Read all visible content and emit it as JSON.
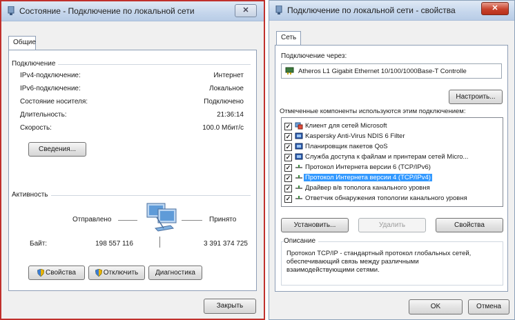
{
  "left_window": {
    "title": "Состояние - Подключение по локальной сети",
    "close_label": "✕",
    "tab": "Общие",
    "connection_group": "Подключение",
    "rows": [
      {
        "label": "IPv4-подключение:",
        "value": "Интернет"
      },
      {
        "label": "IPv6-подключение:",
        "value": "Локальное"
      },
      {
        "label": "Состояние носителя:",
        "value": "Подключено"
      },
      {
        "label": "Длительность:",
        "value": "21:36:14"
      },
      {
        "label": "Скорость:",
        "value": "100.0 Мбит/с"
      }
    ],
    "details_button": "Сведения...",
    "activity_group": "Активность",
    "sent_label": "Отправлено",
    "received_label": "Принято",
    "bytes_label": "Байт:",
    "bytes_sent": "198 557 116",
    "bytes_received": "3 391 374 725",
    "properties_button": "Свойства",
    "disable_button": "Отключить",
    "diagnose_button": "Диагностика",
    "close_button": "Закрыть"
  },
  "right_window": {
    "title": "Подключение по локальной сети - свойства",
    "close_label": "✕",
    "tab": "Сеть",
    "connect_using_label": "Подключение через:",
    "adapter_name": "Atheros L1 Gigabit Ethernet 10/100/1000Base-T Controlle",
    "configure_button": "Настроить...",
    "components_label": "Отмеченные компоненты используются этим подключением:",
    "components": [
      {
        "label": "Клиент для сетей Microsoft",
        "checked": true,
        "icon": "client-icon",
        "selected": false
      },
      {
        "label": "Kaspersky Anti-Virus NDIS 6 Filter",
        "checked": true,
        "icon": "service-icon",
        "selected": false
      },
      {
        "label": "Планировщик пакетов QoS",
        "checked": true,
        "icon": "service-icon",
        "selected": false
      },
      {
        "label": "Служба доступа к файлам и принтерам сетей Micro...",
        "checked": true,
        "icon": "service-icon",
        "selected": false
      },
      {
        "label": "Протокол Интернета версии 6 (TCP/IPv6)",
        "checked": true,
        "icon": "protocol-icon",
        "selected": false
      },
      {
        "label": "Протокол Интернета версии 4 (TCP/IPv4)",
        "checked": true,
        "icon": "protocol-icon",
        "selected": true
      },
      {
        "label": "Драйвер в/в тополога канального уровня",
        "checked": true,
        "icon": "protocol-icon",
        "selected": false
      },
      {
        "label": "Ответчик обнаружения топологии канального уровня",
        "checked": true,
        "icon": "protocol-icon",
        "selected": false
      }
    ],
    "install_button": "Установить...",
    "remove_button": "Удалить",
    "properties_button": "Свойства",
    "description_group": "Описание",
    "description_text": "Протокол TCP/IP - стандартный протокол глобальных сетей, обеспечивающий связь между различными взаимодействующими сетями.",
    "ok_button": "OK",
    "cancel_button": "Отмена"
  },
  "colors": {
    "selection": "#3399ff",
    "close_red": "#c7422c",
    "left_border": "#c0302c"
  }
}
